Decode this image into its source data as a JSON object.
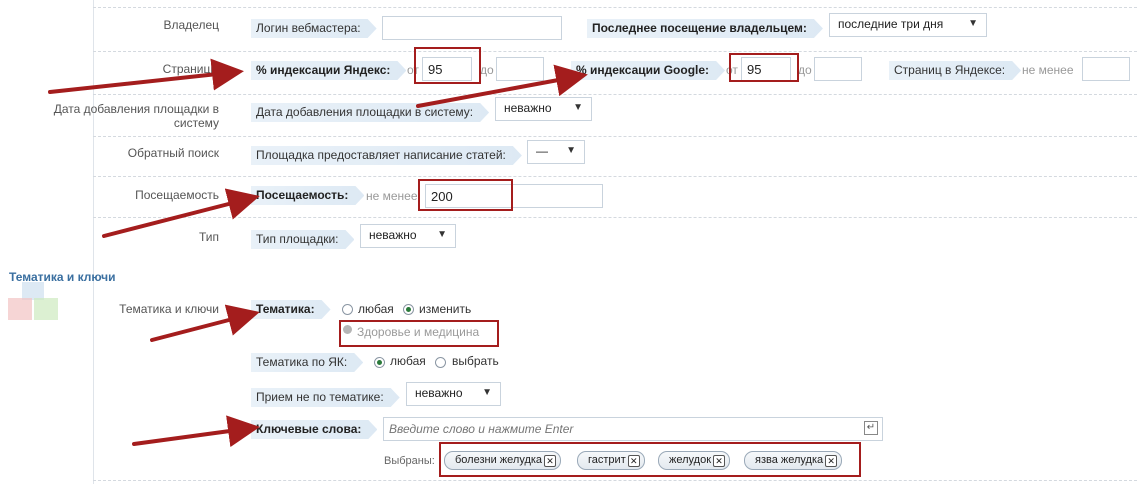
{
  "rows": {
    "owner": "Владелец",
    "pages": "Страницы",
    "date_added": "Дата добавления площадки в систему",
    "reverse_search": "Обратный поиск",
    "traffic": "Посещаемость",
    "type": "Тип",
    "topic_keys": "Тематика и ключи"
  },
  "section_title": "Тематика и ключи",
  "owner": {
    "login_label": "Логин вебмастера:",
    "login_value": "",
    "last_visit_label": "Последнее посещение владельцем:",
    "last_visit_value": "последние три дня"
  },
  "pages": {
    "yandex_label": "% индексации Яндекс:",
    "from": "от",
    "to": "до",
    "yandex_from": "95",
    "yandex_to": "",
    "google_label": "% индексации Google:",
    "google_from": "95",
    "google_to": "",
    "pages_yandex_label": "Страниц в Яндексе:",
    "not_less": "не менее",
    "pages_yandex_value": ""
  },
  "date_added": {
    "label": "Дата добавления площадки в систему:",
    "value": "неважно"
  },
  "reverse_search": {
    "label": "Площадка предоставляет написание статей:",
    "value": "—"
  },
  "traffic": {
    "label": "Посещаемость:",
    "not_less": "не менее",
    "value": "200"
  },
  "type": {
    "label": "Тип площадки:",
    "value": "неважно"
  },
  "topic": {
    "label": "Тематика:",
    "opt_any": "любая",
    "opt_change": "изменить",
    "selected_topic": "Здоровье и медицина",
    "yak_label": "Тематика по ЯК:",
    "yak_any": "любая",
    "yak_choose": "выбрать",
    "off_topic_label": "Прием не по тематике:",
    "off_topic_value": "неважно",
    "keywords_label": "Ключевые слова:",
    "keywords_placeholder": "Введите слово и нажмите Enter",
    "selected_label": "Выбраны:",
    "chips": [
      "болезни желудка",
      "гастрит",
      "желудок",
      "язва желудка"
    ]
  },
  "icons": {
    "dropdown": "chevron-down-icon",
    "remove": "close-icon",
    "enter": "enter-icon",
    "check": "check-icon"
  },
  "colors": {
    "annotation_red": "#a41d1d",
    "section_blue": "#3a6fa0"
  }
}
